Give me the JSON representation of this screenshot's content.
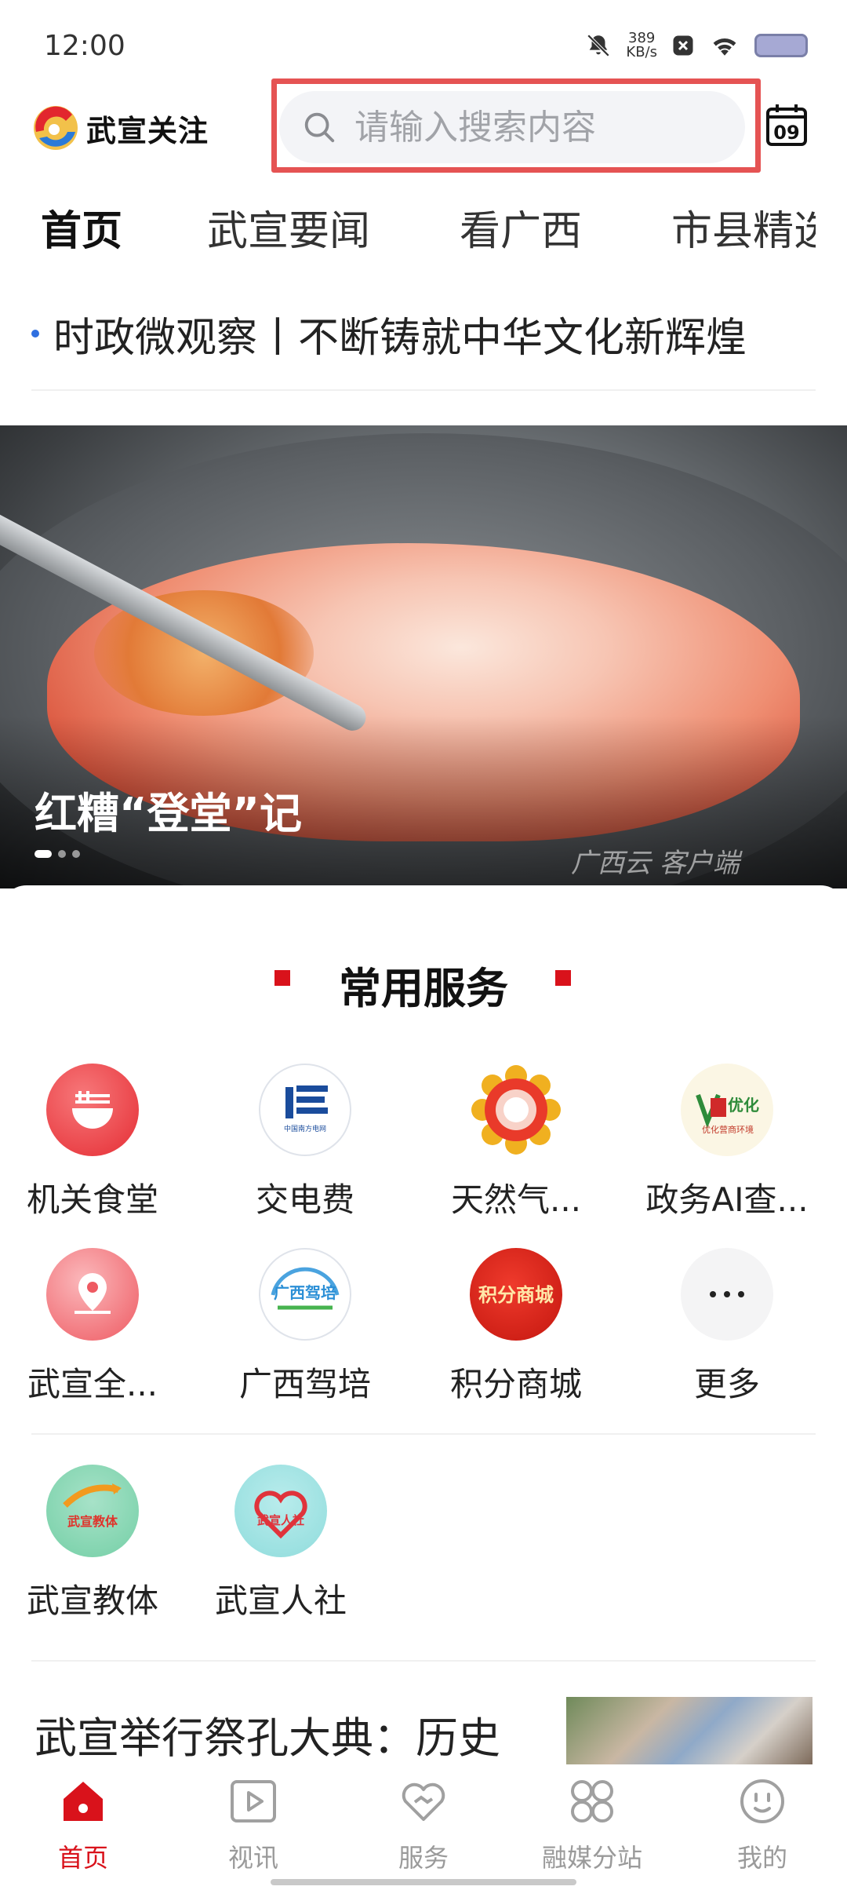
{
  "status_bar": {
    "time": "12:00",
    "speed_value": "389",
    "speed_unit": "KB/s",
    "icons": [
      "bell-muted-icon",
      "x-notification-icon",
      "wifi-icon",
      "battery-icon"
    ]
  },
  "header": {
    "logo_text": "武宣关注",
    "search": {
      "placeholder": "请输入搜索内容"
    },
    "calendar_day": "09"
  },
  "tabs": [
    {
      "label": "首页",
      "active": true
    },
    {
      "label": "武宣要闻",
      "active": false
    },
    {
      "label": "看广西",
      "active": false
    },
    {
      "label": "市县精选",
      "active": false
    }
  ],
  "ticker": {
    "text": "时政微观察丨不断铸就中华文化新辉煌"
  },
  "banner": {
    "title": "红糟“登堂”记",
    "watermark": "广西云 客户端",
    "dot_count": 3,
    "active_index": 0
  },
  "services": {
    "title": "常用服务",
    "items": [
      {
        "label": "机关食堂",
        "icon": "canteen-icon",
        "badge": ""
      },
      {
        "label": "交电费",
        "icon": "power-grid-icon",
        "badge": "中国南方电网"
      },
      {
        "label": "天然气...",
        "icon": "gas-icon",
        "badge": ""
      },
      {
        "label": "政务AI查...",
        "icon": "gov-ai-icon",
        "badge": "优化营商环境"
      },
      {
        "label": "武宣全...",
        "icon": "location-icon",
        "badge": ""
      },
      {
        "label": "广西驾培",
        "icon": "driving-school-icon",
        "badge": "广西驾培"
      },
      {
        "label": "积分商城",
        "icon": "points-mall-icon",
        "badge": "积分商城"
      },
      {
        "label": "更多",
        "icon": "more-icon",
        "badge": ""
      },
      {
        "label": "武宣教体",
        "icon": "education-icon",
        "badge": "武宣教体"
      },
      {
        "label": "武宣人社",
        "icon": "hr-social-icon",
        "badge": "武宣人社"
      }
    ]
  },
  "news": {
    "title": "武宣举行祭孔大典：历史"
  },
  "bottom_nav": [
    {
      "label": "首页",
      "icon": "home-icon",
      "active": true
    },
    {
      "label": "视讯",
      "icon": "video-icon",
      "active": false
    },
    {
      "label": "服务",
      "icon": "service-heart-icon",
      "active": false
    },
    {
      "label": "融媒分站",
      "icon": "substation-grid-icon",
      "active": false
    },
    {
      "label": "我的",
      "icon": "profile-face-icon",
      "active": false
    }
  ],
  "colors": {
    "accent": "#d9121b",
    "search_outline": "#e55353",
    "ticker_dot": "#2f6fe0"
  }
}
